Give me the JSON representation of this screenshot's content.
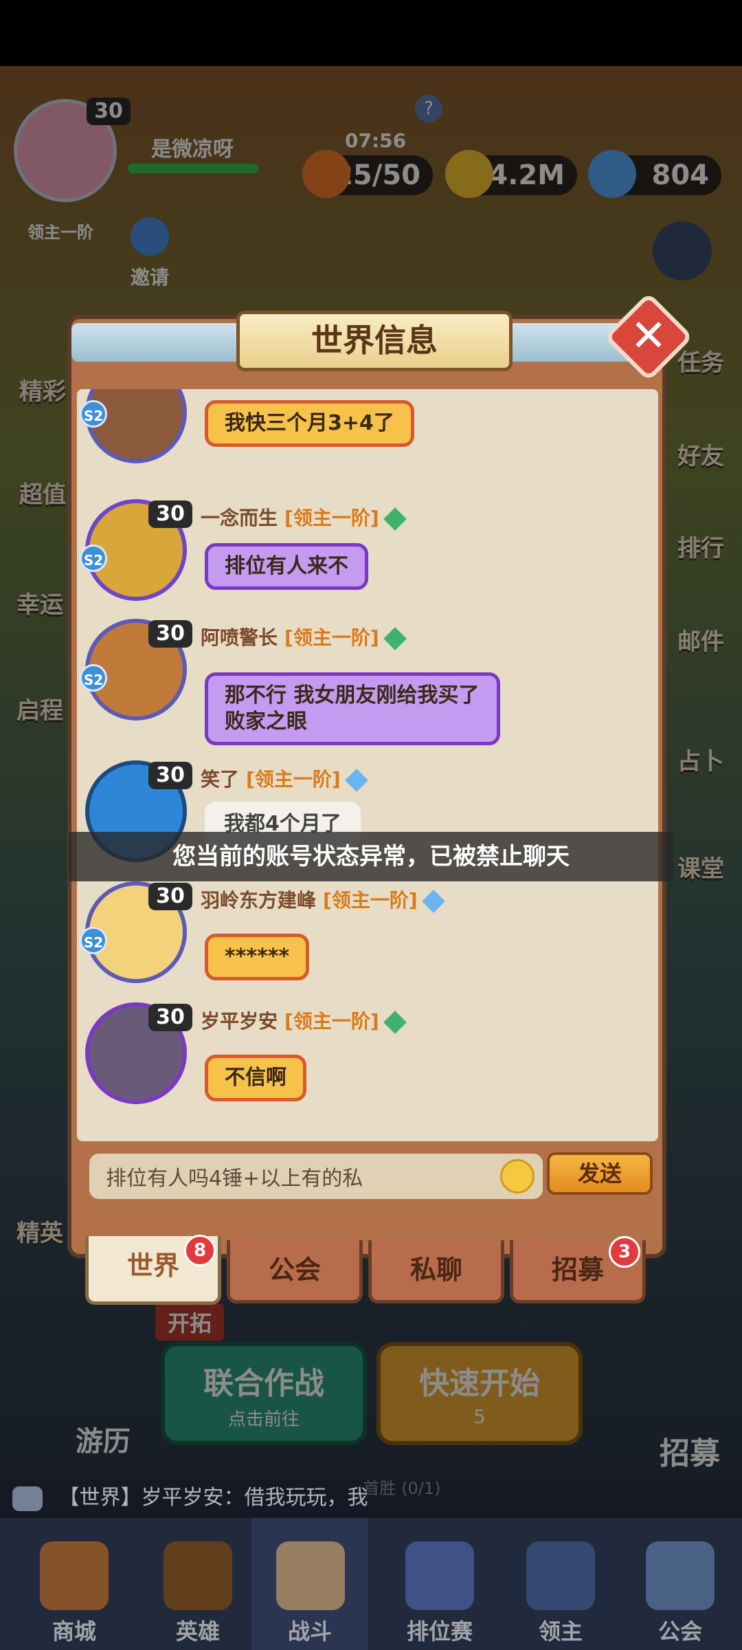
{
  "hud": {
    "level": "30",
    "player_name": "是微凉呀",
    "rank_label": "领主一阶",
    "invite_label": "邀请",
    "timer": "07:56",
    "stamina": "25/50",
    "gold": "14.2M",
    "gems": "804",
    "help_icon": "?"
  },
  "side_left": [
    "精彩",
    "超值",
    "幸运",
    "启程",
    "精英"
  ],
  "side_right": [
    "任务",
    "好友",
    "排行",
    "邮件",
    "占卜",
    "课堂"
  ],
  "dialog": {
    "title": "世界信息",
    "close_label": "✕"
  },
  "messages": [
    {
      "level": "",
      "season": "S2",
      "name": "",
      "rank": "",
      "text": "我快三个月3+4了",
      "style": "gold"
    },
    {
      "level": "30",
      "season": "S2",
      "name": "一念而生",
      "rank": "[领主一阶]",
      "text": "排位有人来不",
      "style": "purple"
    },
    {
      "level": "30",
      "season": "S2",
      "name": "阿喷警长",
      "rank": "[领主一阶]",
      "text": "那不行  我女朋友刚给我买了败家之眼",
      "style": "purple"
    },
    {
      "level": "30",
      "season": "",
      "name": "笑了",
      "rank": "[领主一阶]",
      "text": "我都4个月了",
      "style": "white"
    },
    {
      "level": "30",
      "season": "S2",
      "name": "羽岭东方建峰",
      "rank": "[领主一阶]",
      "text": "******",
      "style": "gold"
    },
    {
      "level": "30",
      "season": "",
      "name": "岁平岁安",
      "rank": "[领主一阶]",
      "text": "不信啊",
      "style": "gold"
    }
  ],
  "ban_notice": "您当前的账号状态异常，已被禁止聊天",
  "input": {
    "value": "排位有人吗4锤+以上有的私",
    "send_label": "发送"
  },
  "tabs": [
    {
      "label": "世界",
      "badge": "8",
      "active": true
    },
    {
      "label": "公会",
      "badge": ""
    },
    {
      "label": "私聊",
      "badge": ""
    },
    {
      "label": "招募",
      "badge": "3"
    }
  ],
  "behind": {
    "coop_title": "联合作战",
    "coop_sub": "点击前往",
    "quick_title": "快速开始",
    "quick_cost": "5",
    "first_win": "首胜 (0/1)",
    "travel": "游历",
    "recruit": "招募",
    "explore": "开拓"
  },
  "ticker": "【世界】岁平岁安：借我玩玩，我",
  "bottom_nav": [
    "商城",
    "英雄",
    "战斗",
    "排位赛",
    "领主",
    "公会"
  ],
  "colors": {
    "gold_bubble": "#f6c24a",
    "purple_bubble": "#c49bf0",
    "rank_text": "#d97a17",
    "badge_red": "#e23a3f"
  }
}
